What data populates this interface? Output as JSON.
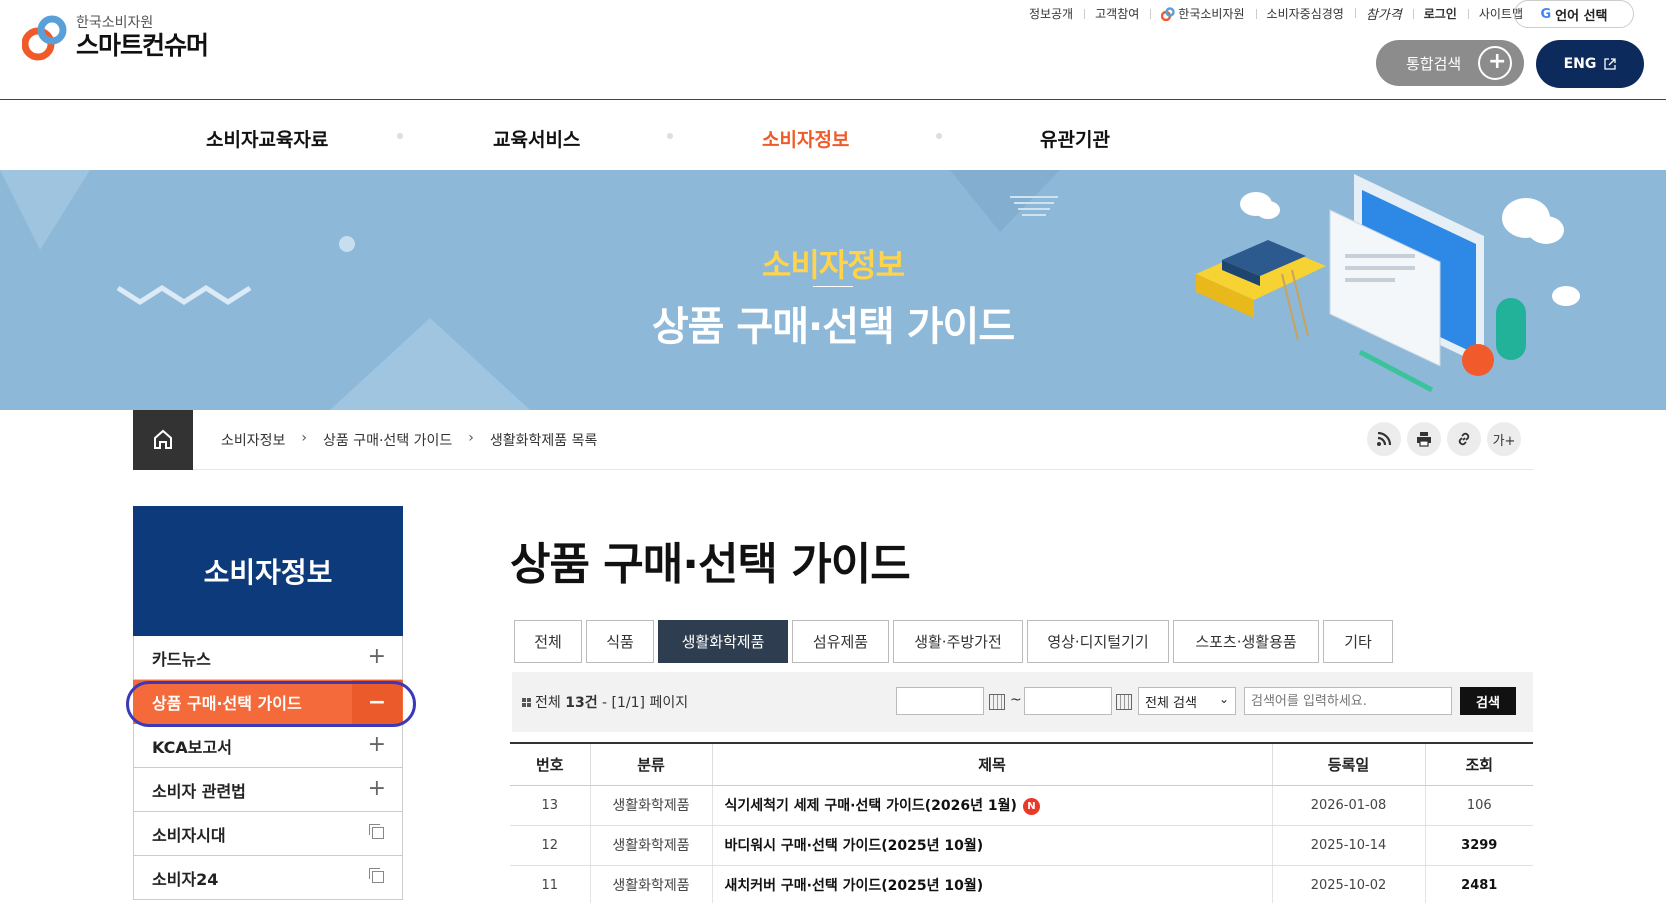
{
  "logo": {
    "small": "한국소비자원",
    "big": "스마트컨슈머"
  },
  "util_nav": [
    "정보공개",
    "고객참여",
    "한국소비자원",
    "소비자중심경영",
    "참가격",
    "로그인",
    "사이트맵"
  ],
  "lang_button": "언어 선택",
  "search_button": "통합검색",
  "eng_button": "ENG",
  "gnb": [
    "소비자교육자료",
    "교육서비스",
    "소비자정보",
    "유관기관"
  ],
  "banner": {
    "subtitle": "소비자정보",
    "title": "상품 구매·선택 가이드"
  },
  "breadcrumb": [
    "소비자정보",
    "상품 구매·선택 가이드",
    "생활화학제품 목록"
  ],
  "tools": {
    "font_size": "가+"
  },
  "lnb": {
    "title": "소비자정보",
    "items": [
      "카드뉴스",
      "상품 구매·선택 가이드",
      "KCA보고서",
      "소비자 관련법",
      "소비자시대",
      "소비자24"
    ]
  },
  "page_title": "상품 구매·선택 가이드",
  "tabs": [
    "전체",
    "식품",
    "생활화학제품",
    "섬유제품",
    "생활·주방가전",
    "영상·디지털기기",
    "스포츠·생활용품",
    "기타"
  ],
  "search": {
    "total_prefix": "전체 ",
    "total_count": "13건",
    "page_info": " - [1/1] 페이지",
    "tilde": "~",
    "select_value": "전체 검색",
    "placeholder": "검색어를 입력하세요.",
    "button": "검색"
  },
  "table": {
    "headers": [
      "번호",
      "분류",
      "제목",
      "등록일",
      "조회"
    ],
    "rows": [
      {
        "no": "13",
        "category": "생활화학제품",
        "title": "식기세척기 세제 구매·선택 가이드(2026년 1월)",
        "date": "2026-01-08",
        "views": "106",
        "badge": "N"
      },
      {
        "no": "12",
        "category": "생활화학제품",
        "title": "바디워시 구매·선택 가이드(2025년 10월)",
        "date": "2025-10-14",
        "views": "3299"
      },
      {
        "no": "11",
        "category": "생활화학제품",
        "title": "새치커버 구매·선택 가이드(2025년 10월)",
        "date": "2025-10-02",
        "views": "2481"
      }
    ]
  },
  "colors": {
    "accent": "#f05a28",
    "navy": "#0d2a5c",
    "lnb_head": "#0d3a7a",
    "banner": "#8db8d8",
    "tab_active": "#2f3d51"
  }
}
